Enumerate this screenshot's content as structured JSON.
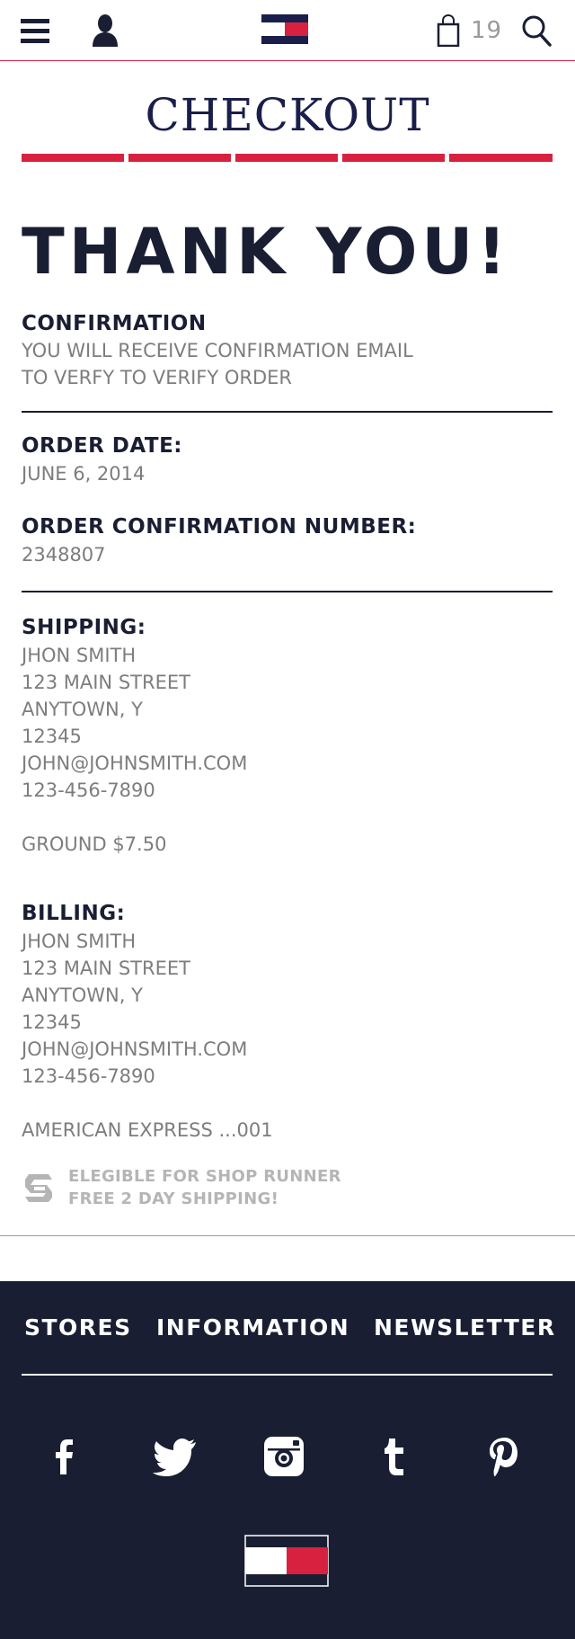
{
  "header": {
    "bag_count": "19",
    "icons": [
      "menu-icon",
      "user-icon",
      "flag-logo",
      "shopping-bag-icon",
      "search-icon"
    ]
  },
  "checkout": {
    "title": "CHECKOUT",
    "progress_steps": 5
  },
  "thanks": "THANK YOU!",
  "confirmation": {
    "label": "CONFIRMATION",
    "line1": "YOU WILL RECEIVE CONFIRMATION EMAIL",
    "line2": "TO VERFY TO VERIFY ORDER"
  },
  "order": {
    "date_label": "ORDER DATE:",
    "date": "JUNE 6, 2014",
    "number_label": "ORDER CONFIRMATION NUMBER:",
    "number": "2348807"
  },
  "shipping": {
    "label": "SHIPPING:",
    "name": "JHON SMITH",
    "street": "123 MAIN STREET",
    "city": "ANYTOWN, Y",
    "zip": "12345",
    "email": "JOHN@JOHNSMITH.COM",
    "phone": "123-456-7890",
    "method": "GROUND $7.50"
  },
  "billing": {
    "label": "BILLING:",
    "name": "JHON SMITH",
    "street": "123 MAIN STREET",
    "city": "ANYTOWN, Y",
    "zip": "12345",
    "email": "JOHN@JOHNSMITH.COM",
    "phone": "123-456-7890",
    "payment": "AMERICAN EXPRESS ...001"
  },
  "shoprunner": {
    "line1": "ELEGIBLE FOR SHOP RUNNER",
    "line2": "FREE 2 DAY SHIPPING!"
  },
  "footer": {
    "nav": [
      "STORES",
      "INFORMATION",
      "NEWSLETTER"
    ],
    "social": [
      "facebook-icon",
      "twitter-icon",
      "instagram-icon",
      "tumblr-icon",
      "pinterest-icon"
    ]
  },
  "colors": {
    "navy": "#1a1e33",
    "red": "#d8213f",
    "gray_text": "#7d7d7d",
    "light_gray": "#b5b5b5"
  }
}
